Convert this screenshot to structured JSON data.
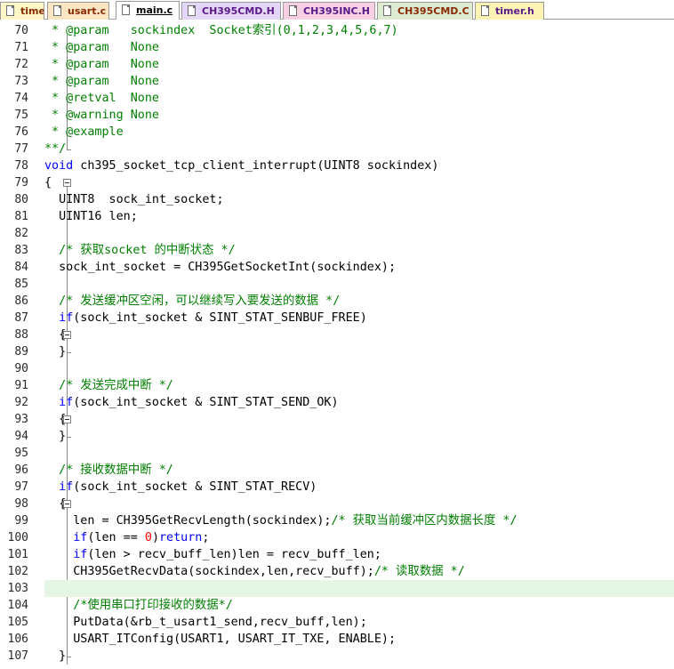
{
  "tabs": [
    {
      "label": "timer.c",
      "kind": "c",
      "active": false,
      "bg": "#fdf7c8"
    },
    {
      "label": "usart.c",
      "kind": "c",
      "active": false,
      "bg": "#fbe6c4"
    },
    {
      "label": "main.c",
      "kind": "c",
      "active": true,
      "bg": "#ffffff"
    },
    {
      "label": "CH395CMD.H",
      "kind": "h",
      "active": false,
      "bg": "#e4d6f6"
    },
    {
      "label": "CH395INC.H",
      "kind": "h",
      "active": false,
      "bg": "#f7d0e4"
    },
    {
      "label": "CH395CMD.C",
      "kind": "c",
      "active": false,
      "bg": "#dcebd2"
    },
    {
      "label": "timer.h",
      "kind": "h",
      "active": false,
      "bg": "#fdf3b4"
    }
  ],
  "colors": {
    "comment": "#007f00",
    "keyword": "#0000ff",
    "number": "#ff0000",
    "current_line": "#e5f6e5"
  },
  "editor": {
    "current_line": 103,
    "lines": [
      {
        "n": "70",
        "tokens": [
          {
            "t": " * @param   sockindex  Socket索引(0,1,2,3,4,5,6,7)",
            "c": "comment"
          }
        ]
      },
      {
        "n": "71",
        "tokens": [
          {
            "t": " * @param   None",
            "c": "comment"
          }
        ]
      },
      {
        "n": "72",
        "tokens": [
          {
            "t": " * @param   None",
            "c": "comment"
          }
        ]
      },
      {
        "n": "73",
        "tokens": [
          {
            "t": " * @param   None",
            "c": "comment"
          }
        ]
      },
      {
        "n": "74",
        "tokens": [
          {
            "t": " * @retval  None",
            "c": "comment"
          }
        ]
      },
      {
        "n": "75",
        "tokens": [
          {
            "t": " * @warning None",
            "c": "comment"
          }
        ]
      },
      {
        "n": "76",
        "tokens": [
          {
            "t": " * @example",
            "c": "comment"
          }
        ]
      },
      {
        "n": "77",
        "tokens": [
          {
            "t": "**/",
            "c": "comment"
          }
        ]
      },
      {
        "n": "78",
        "tokens": [
          {
            "t": "void",
            "c": "kw"
          },
          {
            "t": " ch395_socket_tcp_client_interrupt(UINT8 sockindex)",
            "c": "plain"
          }
        ]
      },
      {
        "n": "79",
        "tokens": [
          {
            "t": "{",
            "c": "plain"
          }
        ]
      },
      {
        "n": "80",
        "tokens": [
          {
            "t": "  UINT8  sock_int_socket;",
            "c": "plain"
          }
        ]
      },
      {
        "n": "81",
        "tokens": [
          {
            "t": "  UINT16 len;",
            "c": "plain"
          }
        ]
      },
      {
        "n": "82",
        "tokens": [
          {
            "t": "",
            "c": "plain"
          }
        ]
      },
      {
        "n": "83",
        "tokens": [
          {
            "t": "  /* 获取socket 的中断状态 */",
            "c": "comment"
          }
        ]
      },
      {
        "n": "84",
        "tokens": [
          {
            "t": "  sock_int_socket = CH395GetSocketInt(sockindex);",
            "c": "plain"
          }
        ]
      },
      {
        "n": "85",
        "tokens": [
          {
            "t": "",
            "c": "plain"
          }
        ]
      },
      {
        "n": "86",
        "tokens": [
          {
            "t": "  /* 发送缓冲区空闲，可以继续写入要发送的数据 */",
            "c": "comment"
          }
        ]
      },
      {
        "n": "87",
        "tokens": [
          {
            "t": "  ",
            "c": "plain"
          },
          {
            "t": "if",
            "c": "kw"
          },
          {
            "t": "(sock_int_socket & SINT_STAT_SENBUF_FREE)",
            "c": "plain"
          }
        ]
      },
      {
        "n": "88",
        "tokens": [
          {
            "t": "  {",
            "c": "plain"
          }
        ]
      },
      {
        "n": "89",
        "tokens": [
          {
            "t": "  }",
            "c": "plain"
          }
        ]
      },
      {
        "n": "90",
        "tokens": [
          {
            "t": "",
            "c": "plain"
          }
        ]
      },
      {
        "n": "91",
        "tokens": [
          {
            "t": "  /* 发送完成中断 */",
            "c": "comment"
          }
        ]
      },
      {
        "n": "92",
        "tokens": [
          {
            "t": "  ",
            "c": "plain"
          },
          {
            "t": "if",
            "c": "kw"
          },
          {
            "t": "(sock_int_socket & SINT_STAT_SEND_OK)",
            "c": "plain"
          }
        ]
      },
      {
        "n": "93",
        "tokens": [
          {
            "t": "  {",
            "c": "plain"
          }
        ]
      },
      {
        "n": "94",
        "tokens": [
          {
            "t": "  }",
            "c": "plain"
          }
        ]
      },
      {
        "n": "95",
        "tokens": [
          {
            "t": "",
            "c": "plain"
          }
        ]
      },
      {
        "n": "96",
        "tokens": [
          {
            "t": "  /* 接收数据中断 */",
            "c": "comment"
          }
        ]
      },
      {
        "n": "97",
        "tokens": [
          {
            "t": "  ",
            "c": "plain"
          },
          {
            "t": "if",
            "c": "kw"
          },
          {
            "t": "(sock_int_socket & SINT_STAT_RECV)",
            "c": "plain"
          }
        ]
      },
      {
        "n": "98",
        "tokens": [
          {
            "t": "  {",
            "c": "plain"
          }
        ]
      },
      {
        "n": "99",
        "tokens": [
          {
            "t": "    len = CH395GetRecvLength(sockindex);",
            "c": "plain"
          },
          {
            "t": "/* 获取当前缓冲区内数据长度 */",
            "c": "comment"
          }
        ]
      },
      {
        "n": "100",
        "tokens": [
          {
            "t": "    ",
            "c": "plain"
          },
          {
            "t": "if",
            "c": "kw"
          },
          {
            "t": "(len == ",
            "c": "plain"
          },
          {
            "t": "0",
            "c": "num"
          },
          {
            "t": ")",
            "c": "plain"
          },
          {
            "t": "return",
            "c": "kw"
          },
          {
            "t": ";",
            "c": "plain"
          }
        ]
      },
      {
        "n": "101",
        "tokens": [
          {
            "t": "    ",
            "c": "plain"
          },
          {
            "t": "if",
            "c": "kw"
          },
          {
            "t": "(len > recv_buff_len)len = recv_buff_len;",
            "c": "plain"
          }
        ]
      },
      {
        "n": "102",
        "tokens": [
          {
            "t": "    CH395GetRecvData(sockindex,len,recv_buff);",
            "c": "plain"
          },
          {
            "t": "/* 读取数据 */",
            "c": "comment"
          }
        ]
      },
      {
        "n": "103",
        "tokens": [
          {
            "t": "",
            "c": "plain"
          }
        ]
      },
      {
        "n": "104",
        "tokens": [
          {
            "t": "    /*使用串口打印接收的数据*/",
            "c": "comment"
          }
        ]
      },
      {
        "n": "105",
        "tokens": [
          {
            "t": "    PutData(&rb_t_usart1_send,recv_buff,len);",
            "c": "plain"
          }
        ]
      },
      {
        "n": "106",
        "tokens": [
          {
            "t": "    USART_ITConfig(USART1, USART_IT_TXE, ENABLE);",
            "c": "plain"
          }
        ]
      },
      {
        "n": "107",
        "tokens": [
          {
            "t": "  }",
            "c": "plain"
          }
        ]
      }
    ]
  }
}
